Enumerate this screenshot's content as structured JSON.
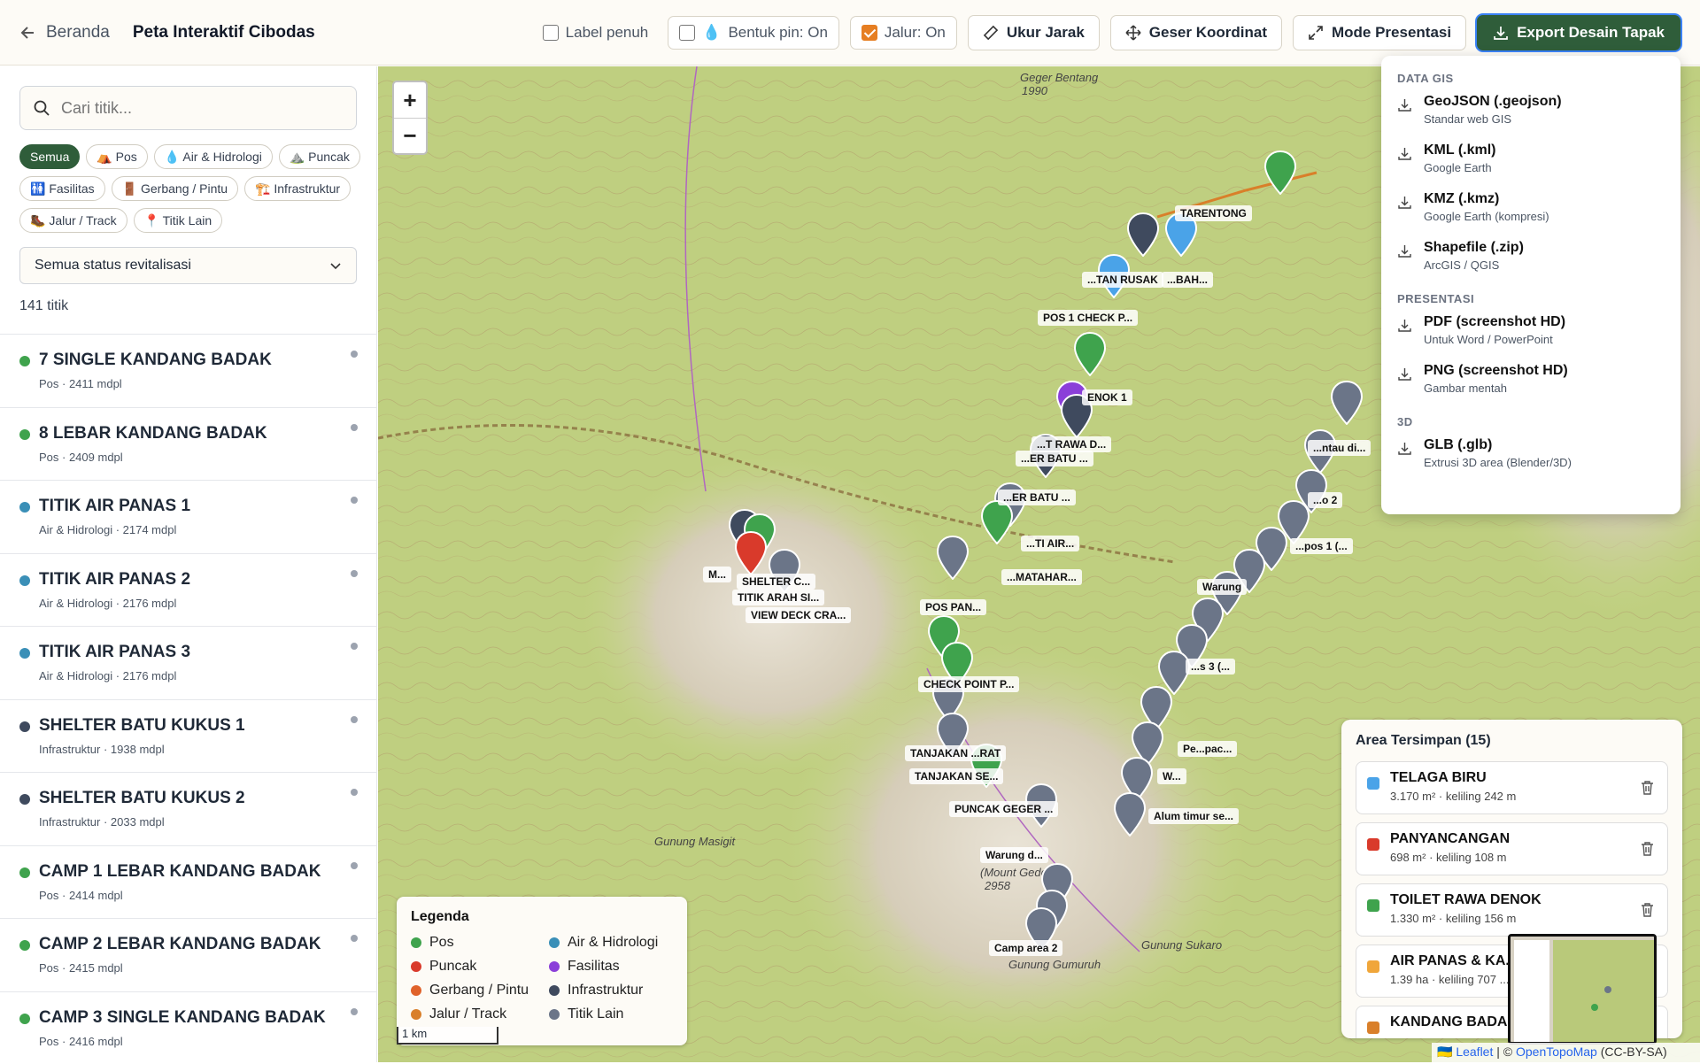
{
  "header": {
    "back_label": "Beranda",
    "title": "Peta Interaktif Cibodas",
    "label_full": "Label penuh",
    "pin_shape": "Bentuk pin: On",
    "track": "Jalur: On",
    "measure": "Ukur Jarak",
    "shift": "Geser Koordinat",
    "presentation": "Mode Presentasi",
    "export": "Export Desain Tapak"
  },
  "sidebar": {
    "search_placeholder": "Cari titik...",
    "chips": [
      "Semua",
      "⛺ Pos",
      "💧 Air & Hidrologi",
      "⛰️ Puncak",
      "🚻 Fasilitas",
      "🚪 Gerbang / Pintu",
      "🏗️ Infrastruktur",
      "🥾 Jalur / Track",
      "📍 Titik Lain"
    ],
    "status_select": "Semua status revitalisasi",
    "count": "141 titik",
    "items": [
      {
        "name": "7 SINGLE KANDANG BADAK",
        "meta": "Pos · 2411 mdpl",
        "color": "#3fa34d"
      },
      {
        "name": "8 LEBAR KANDANG BADAK",
        "meta": "Pos · 2409 mdpl",
        "color": "#3fa34d"
      },
      {
        "name": "TITIK AIR PANAS 1",
        "meta": "Air & Hidrologi · 2174 mdpl",
        "color": "#3a8fb7"
      },
      {
        "name": "TITIK AIR PANAS 2",
        "meta": "Air & Hidrologi · 2176 mdpl",
        "color": "#3a8fb7"
      },
      {
        "name": "TITIK AIR PANAS 3",
        "meta": "Air & Hidrologi · 2176 mdpl",
        "color": "#3a8fb7"
      },
      {
        "name": "SHELTER BATU KUKUS 1",
        "meta": "Infrastruktur · 1938 mdpl",
        "color": "#3f4a5e"
      },
      {
        "name": "SHELTER BATU KUKUS 2",
        "meta": "Infrastruktur · 2033 mdpl",
        "color": "#3f4a5e"
      },
      {
        "name": "CAMP 1 LEBAR KANDANG BADAK",
        "meta": "Pos · 2414 mdpl",
        "color": "#3fa34d"
      },
      {
        "name": "CAMP 2 LEBAR KANDANG BADAK",
        "meta": "Pos · 2415 mdpl",
        "color": "#3fa34d"
      },
      {
        "name": "CAMP 3 SINGLE KANDANG BADAK",
        "meta": "Pos · 2416 mdpl",
        "color": "#3fa34d"
      }
    ]
  },
  "map": {
    "zoom_in": "+",
    "zoom_out": "−",
    "places": [
      "Geger Bentang",
      "1990",
      "Gunung Masigit",
      "Gunung Gumuruh",
      "Gunung Sukaro",
      "(Mount Gede)",
      "2958"
    ],
    "labels": [
      "TARENTONG",
      "...TAN RUSAK",
      "...BAH...",
      "POS 1 CHECK P...",
      "ENOK 1",
      "...T RAWA D...",
      "...ER BATU ...",
      "...ER BATU ...",
      "...TI AIR...",
      "...MATAHAR...",
      "POS PAN...",
      "SHELTER C...",
      "TITIK ARAH SI...",
      "VIEW DECK CRA...",
      "M...",
      "CHECK POINT P...",
      "TANJAKAN ...RAT",
      "TANJAKAN SE...",
      "PUNCAK GEGER ...",
      "Warung d...",
      "Camp area 2",
      "...ntau di...",
      "...o 2",
      "...pos 1 (...",
      "Warung",
      "...s 3 (...",
      "Pe...pac...",
      "W...",
      "Alum timur se..."
    ],
    "legend_title": "Legenda",
    "legend": [
      {
        "label": "Pos",
        "color": "#3fa34d"
      },
      {
        "label": "Air & Hidrologi",
        "color": "#3a8fb7"
      },
      {
        "label": "Puncak",
        "color": "#d93a2b"
      },
      {
        "label": "Fasilitas",
        "color": "#8b3fd9"
      },
      {
        "label": "Gerbang / Pintu",
        "color": "#e0622a"
      },
      {
        "label": "Infrastruktur",
        "color": "#3f4a5e"
      },
      {
        "label": "Jalur / Track",
        "color": "#d97f2a"
      },
      {
        "label": "Titik Lain",
        "color": "#6b7588"
      }
    ],
    "scale": "1 km",
    "attribution_leaflet": "Leaflet",
    "attribution_sep": " | © ",
    "attribution_otm": "OpenTopoMap",
    "attribution_lic": " (CC-BY-SA)"
  },
  "areas": {
    "title": "Area Tersimpan (15)",
    "items": [
      {
        "name": "TELAGA BIRU",
        "meta": "3.170 m² · keliling 242 m",
        "color": "#4aa3e8"
      },
      {
        "name": "PANYANCANGAN",
        "meta": "698 m² · keliling 108 m",
        "color": "#d93a2b"
      },
      {
        "name": "TOILET RAWA DENOK",
        "meta": "1.330 m² · keliling 156 m",
        "color": "#3fa34d"
      },
      {
        "name": "AIR PANAS & KA...",
        "meta": "1.39 ha · keliling 707 ...",
        "color": "#f0a63a"
      },
      {
        "name": "KANDANG BADA...",
        "meta": "",
        "color": "#d97f2a"
      }
    ]
  },
  "export_menu": {
    "section_gis": "DATA GIS",
    "section_pres": "PRESENTASI",
    "section_3d": "3D",
    "options": [
      {
        "label": "GeoJSON (.geojson)",
        "sub": "Standar web GIS"
      },
      {
        "label": "KML (.kml)",
        "sub": "Google Earth"
      },
      {
        "label": "KMZ (.kmz)",
        "sub": "Google Earth (kompresi)"
      },
      {
        "label": "Shapefile (.zip)",
        "sub": "ArcGIS / QGIS"
      },
      {
        "label": "PDF (screenshot HD)",
        "sub": "Untuk Word / PowerPoint"
      },
      {
        "label": "PNG (screenshot HD)",
        "sub": "Gambar mentah"
      },
      {
        "label": "GLB (.glb)",
        "sub": "Extrusi 3D area (Blender/3D)"
      }
    ]
  }
}
